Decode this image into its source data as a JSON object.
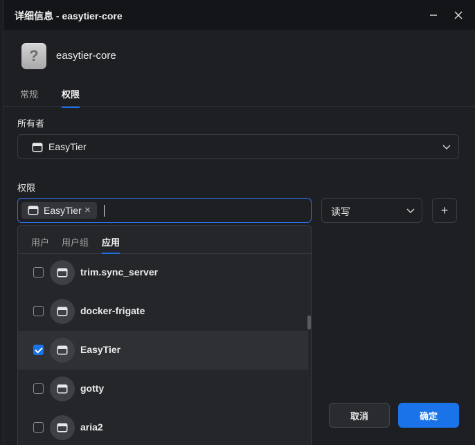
{
  "window": {
    "title": "详细信息 - easytier-core",
    "close_icon": "close-icon",
    "minimize_icon": "minimize-icon"
  },
  "app": {
    "icon": "question-icon",
    "icon_glyph": "?",
    "name": "easytier-core"
  },
  "tabs": [
    {
      "label": "常规",
      "active": false
    },
    {
      "label": "权限",
      "active": true
    }
  ],
  "owner": {
    "label": "所有者",
    "value": "EasyTier",
    "icon": "app-window-icon"
  },
  "permission": {
    "label": "权限",
    "tag": "EasyTier",
    "tag_remove_glyph": "×",
    "mode": "读写",
    "add_glyph": "+"
  },
  "dropdown": {
    "tabs": [
      {
        "label": "用户",
        "active": false
      },
      {
        "label": "用户组",
        "active": false
      },
      {
        "label": "应用",
        "active": true
      }
    ],
    "items": [
      {
        "label": "trim.sync_server",
        "checked": false
      },
      {
        "label": "docker-frigate",
        "checked": false
      },
      {
        "label": "EasyTier",
        "checked": true
      },
      {
        "label": "gotty",
        "checked": false
      },
      {
        "label": "aria2",
        "checked": false
      }
    ]
  },
  "buttons": {
    "cancel": "取消",
    "ok": "确定"
  },
  "colors": {
    "accent": "#1a73e8",
    "background": "#1e1f22",
    "titlebar": "#141518"
  }
}
